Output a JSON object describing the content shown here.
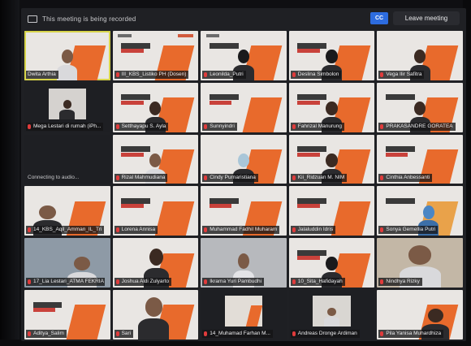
{
  "topbar": {
    "recording_text": "This meeting is being recorded",
    "cc_label": "CC",
    "leave_label": "Leave meeting"
  },
  "tiles": [
    {
      "name": "Dwita Arthia"
    },
    {
      "name": "III_KBS_Listiko PH (Dosen)"
    },
    {
      "name": "Leonilda_Putri"
    },
    {
      "name": "Deslina Simbolon"
    },
    {
      "name": "Vega Ilir Safitra"
    },
    {
      "name": "Mega Lestari di rumah (iPh..."
    },
    {
      "name": "Setthayapu S. Ayla"
    },
    {
      "name": "Sunnyindri"
    },
    {
      "name": "Fahrizal Manurung"
    },
    {
      "name": "PRAKASANDRE GORATEA"
    },
    {
      "name": "Connecting to audio...",
      "connecting": true
    },
    {
      "name": "Rizal Mahmudiana"
    },
    {
      "name": "Cindy Purnaristiana"
    },
    {
      "name": "Kii_Ridzuan M. NIM"
    },
    {
      "name": "Cinthia Anbessanti"
    },
    {
      "name": "14_KBS_Aqil_Amman_IL_Tri"
    },
    {
      "name": "Lorena Annisa"
    },
    {
      "name": "Muhammad Fadhil Muharam"
    },
    {
      "name": "Jalaluddin Idris"
    },
    {
      "name": "Sonya Gemellia Putri"
    },
    {
      "name": "17_Lia Lestari_ATMA FEKRIA"
    },
    {
      "name": "Joshua Aldi Zulyarto"
    },
    {
      "name": "Ikrama Yuri Pambudhi"
    },
    {
      "name": "10_Sita_Hafidayah"
    },
    {
      "name": "Nindhya Rizky"
    },
    {
      "name": "Aditya_Salim"
    },
    {
      "name": "Sari"
    },
    {
      "name": "14_Muhamad Farhan M..."
    },
    {
      "name": "Andreas Dronge Ardiman"
    },
    {
      "name": "Pila Yanisa Muhardhiza"
    }
  ]
}
